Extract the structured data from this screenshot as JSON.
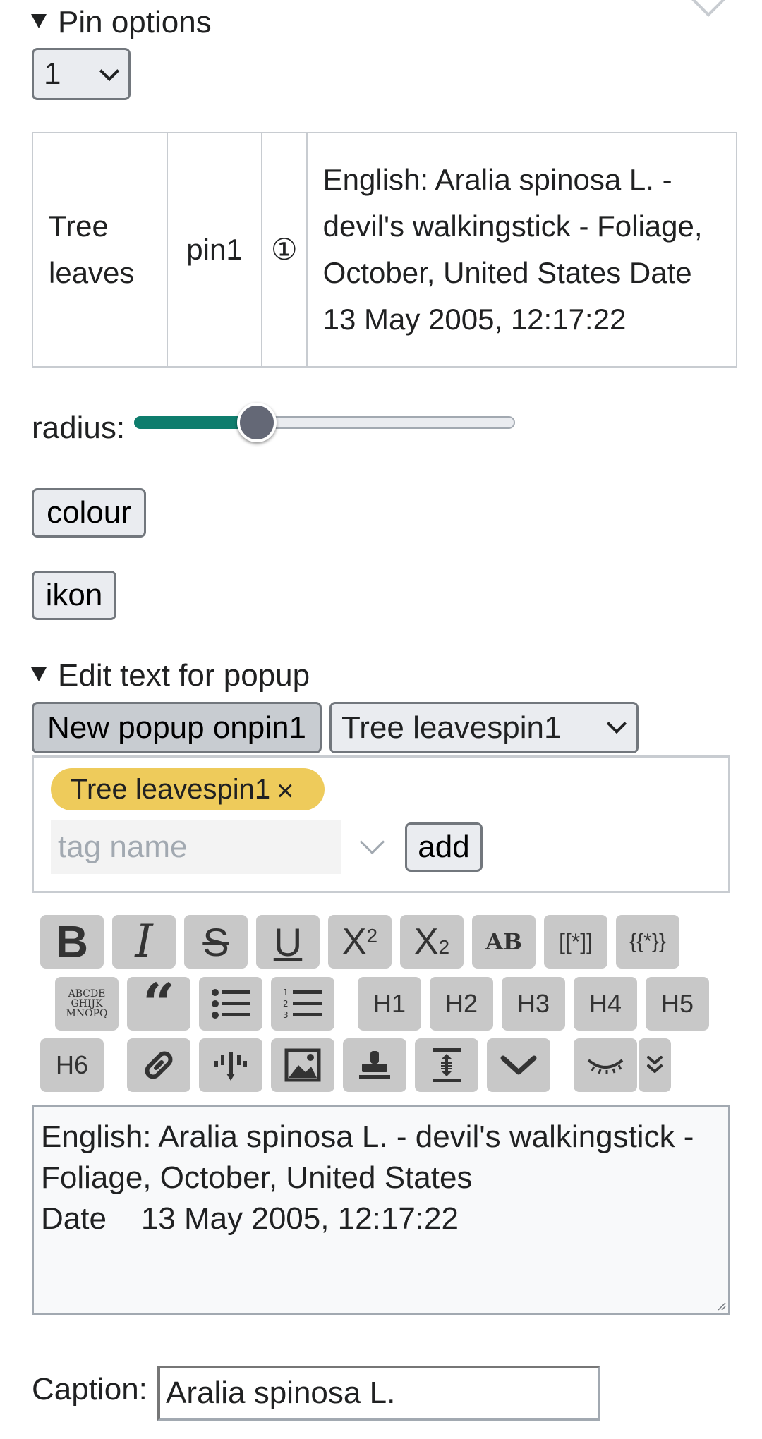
{
  "pin_options": {
    "summary": "Pin options",
    "select_value": "1",
    "table": {
      "row": [
        "Tree leaves",
        "pin1",
        "①",
        "English: Aralia spinosa L. - devil's walkingstick - Foliage, October, United States Date 13 May 2005, 12:17:22"
      ]
    },
    "radius_label": "radius:",
    "radius_value": 0.32,
    "colour_button": "colour",
    "ikon_button": "ikon"
  },
  "popup": {
    "summary": "Edit text for popup",
    "new_popup_button": "New popup onpin1",
    "popup_select_value": "Tree leavespin1",
    "tag_chip": "Tree leavespin1",
    "tag_chip_remove": "×",
    "tag_placeholder": "tag name",
    "add_button": "add",
    "toolbar": {
      "row1": [
        "B",
        "I",
        "S",
        "U",
        "X2",
        "X2sub",
        "AB",
        "[[*]]",
        "{{*}}"
      ],
      "row2": [
        "ABCDE GHIJK MNOPQ",
        "quote",
        "bullet-list",
        "numbered-list",
        "H1",
        "H2",
        "H3",
        "H4",
        "H5"
      ],
      "row3": [
        "H6",
        "link",
        "map-pin",
        "image",
        "stamp",
        "line-height",
        "chevron-down",
        "closed-eye",
        "double-chevron-down"
      ]
    },
    "textarea_lines": [
      "English: Aralia spinosa L. - devil's walkingstick -",
      "Foliage, October, United States",
      "Date    13 May 2005, 12:17:22"
    ],
    "caption_label": "Caption:",
    "caption_value": "Aralia spinosa L."
  }
}
